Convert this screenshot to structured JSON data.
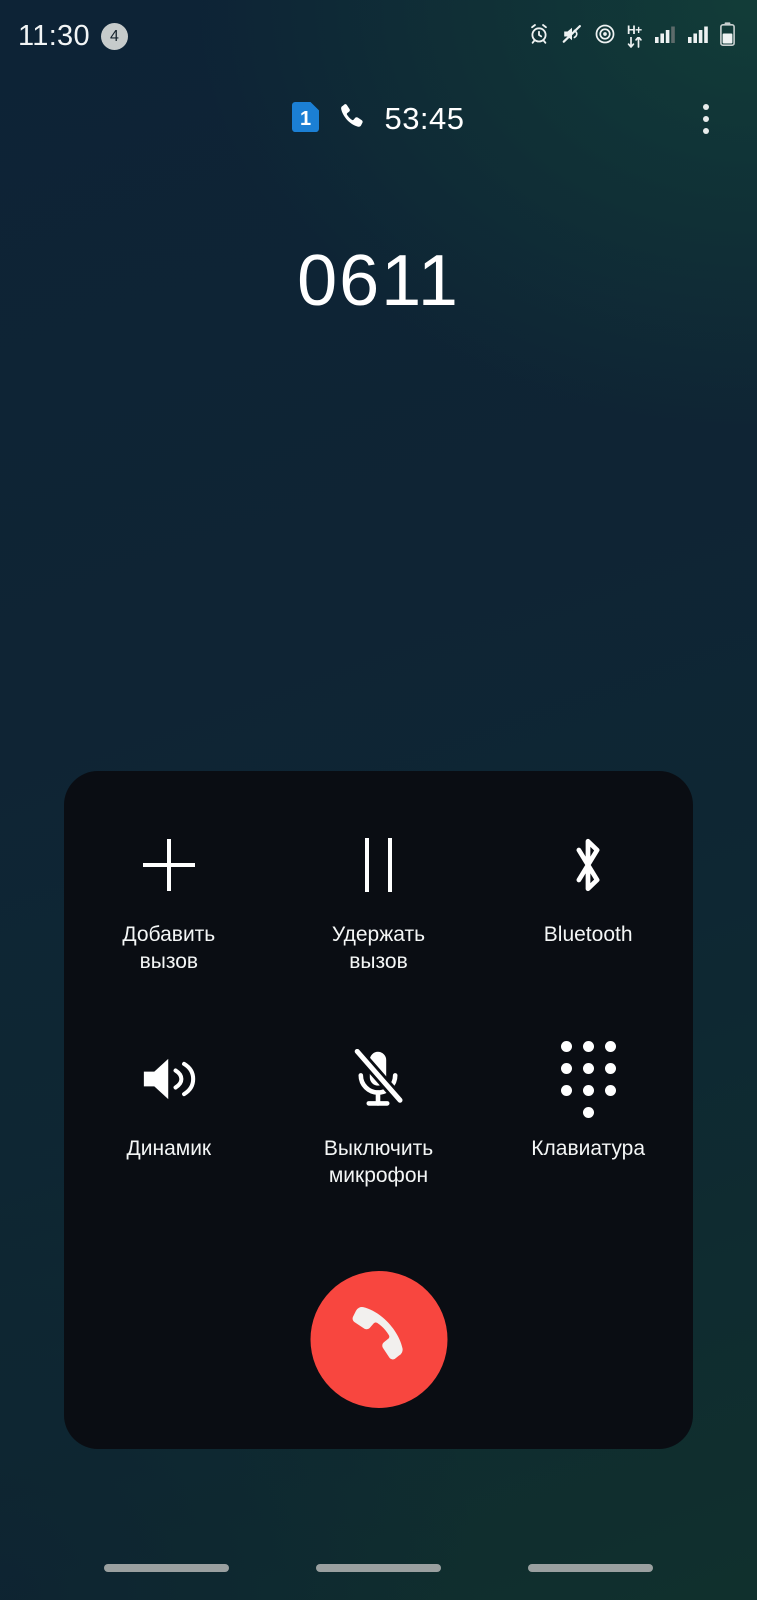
{
  "status_bar": {
    "time": "11:30",
    "notification_count": "4",
    "icons": [
      "alarm-icon",
      "ringer-muted-icon",
      "hotspot-icon",
      "hplus-data-icon",
      "signal-sim1-icon",
      "signal-sim2-icon",
      "battery-icon"
    ],
    "data_type_label": "H+"
  },
  "call_header": {
    "sim_label": "1",
    "sim_icon": "sim-card-icon",
    "call_icon": "phone-handset-icon",
    "duration": "53:45",
    "overflow_icon": "overflow-menu-icon"
  },
  "call": {
    "number": "0611"
  },
  "controls": {
    "buttons": [
      {
        "label": "Добавить\nвызов",
        "icon": "add-call-icon",
        "name": "add-call-button"
      },
      {
        "label": "Удержать\nвызов",
        "icon": "hold-call-icon",
        "name": "hold-call-button"
      },
      {
        "label": "Bluetooth",
        "icon": "bluetooth-icon",
        "name": "bluetooth-button"
      },
      {
        "label": "Динамик",
        "icon": "speaker-icon",
        "name": "speaker-button"
      },
      {
        "label": "Выключить\nмикрофон",
        "icon": "mic-off-icon",
        "name": "mute-button"
      },
      {
        "label": "Клавиатура",
        "icon": "dialpad-icon",
        "name": "keypad-button"
      }
    ],
    "end_call": {
      "icon": "end-call-icon",
      "color": "#f8463f"
    }
  },
  "colors": {
    "panel_background": "#0a0d13",
    "end_call_red": "#f8463f",
    "sim_blue": "#1b7fd4",
    "text_primary": "#ffffff",
    "nav_pill": "#9aa0a0"
  },
  "nav_bar": {
    "pills": [
      "recents-pill",
      "home-pill",
      "back-pill"
    ]
  }
}
